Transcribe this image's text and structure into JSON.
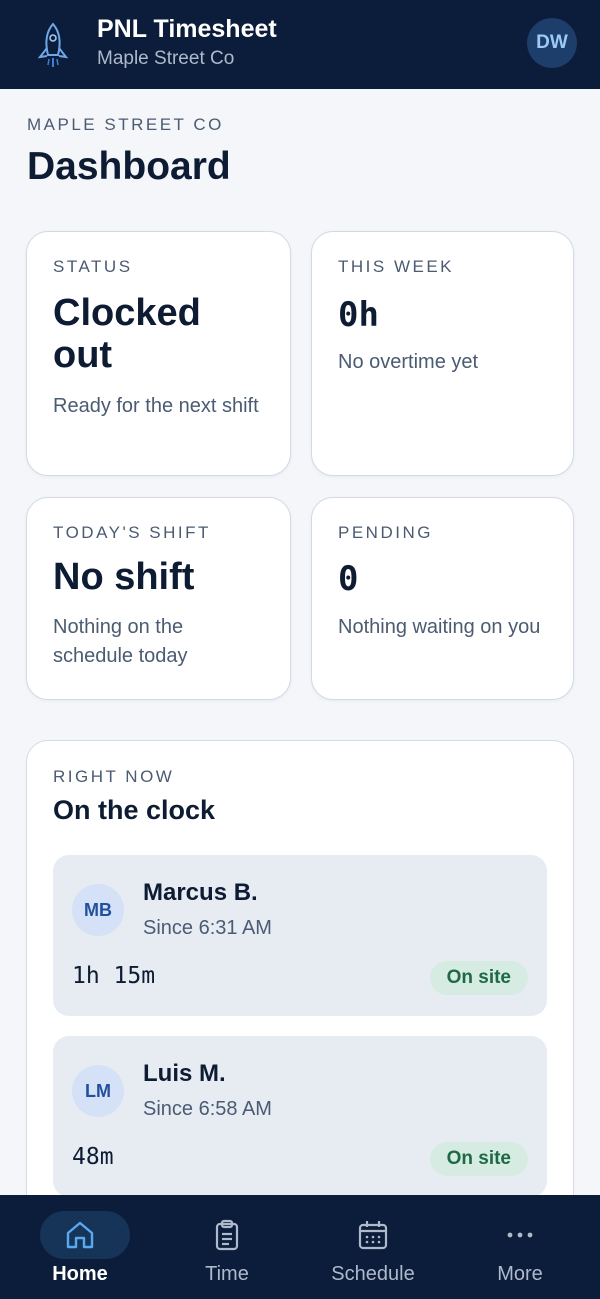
{
  "header": {
    "title": "PNL Timesheet",
    "subtitle": "Maple Street Co",
    "avatar_initials": "DW"
  },
  "page": {
    "company_eyebrow": "MAPLE STREET CO",
    "title": "Dashboard"
  },
  "stats": {
    "status": {
      "label": "STATUS",
      "value": "Clocked out",
      "desc": "Ready for the next shift"
    },
    "this_week": {
      "label": "THIS WEEK",
      "value": "0h",
      "desc": "No overtime yet"
    },
    "todays_shift": {
      "label": "TODAY'S SHIFT",
      "value": "No shift",
      "desc": "Nothing on the schedule today"
    },
    "pending": {
      "label": "PENDING",
      "value": "0",
      "desc": "Nothing waiting on you"
    }
  },
  "on_the_clock": {
    "eyebrow": "RIGHT NOW",
    "title": "On the clock",
    "workers": [
      {
        "initials": "MB",
        "name": "Marcus B.",
        "since": "Since 6:31 AM",
        "duration": "1h 15m",
        "badge": "On site"
      },
      {
        "initials": "LM",
        "name": "Luis M.",
        "since": "Since 6:58 AM",
        "duration": "48m",
        "badge": "On site"
      }
    ]
  },
  "nav": {
    "items": [
      {
        "label": "Home",
        "icon": "home-icon",
        "active": true
      },
      {
        "label": "Time",
        "icon": "clipboard-icon",
        "active": false
      },
      {
        "label": "Schedule",
        "icon": "calendar-icon",
        "active": false
      },
      {
        "label": "More",
        "icon": "more-icon",
        "active": false
      }
    ]
  },
  "colors": {
    "header_bg": "#0b1d3a",
    "page_bg": "#f4f6fa",
    "accent": "#4f9be6",
    "badge_bg": "#d6ebe2",
    "badge_text": "#1e6a46"
  }
}
